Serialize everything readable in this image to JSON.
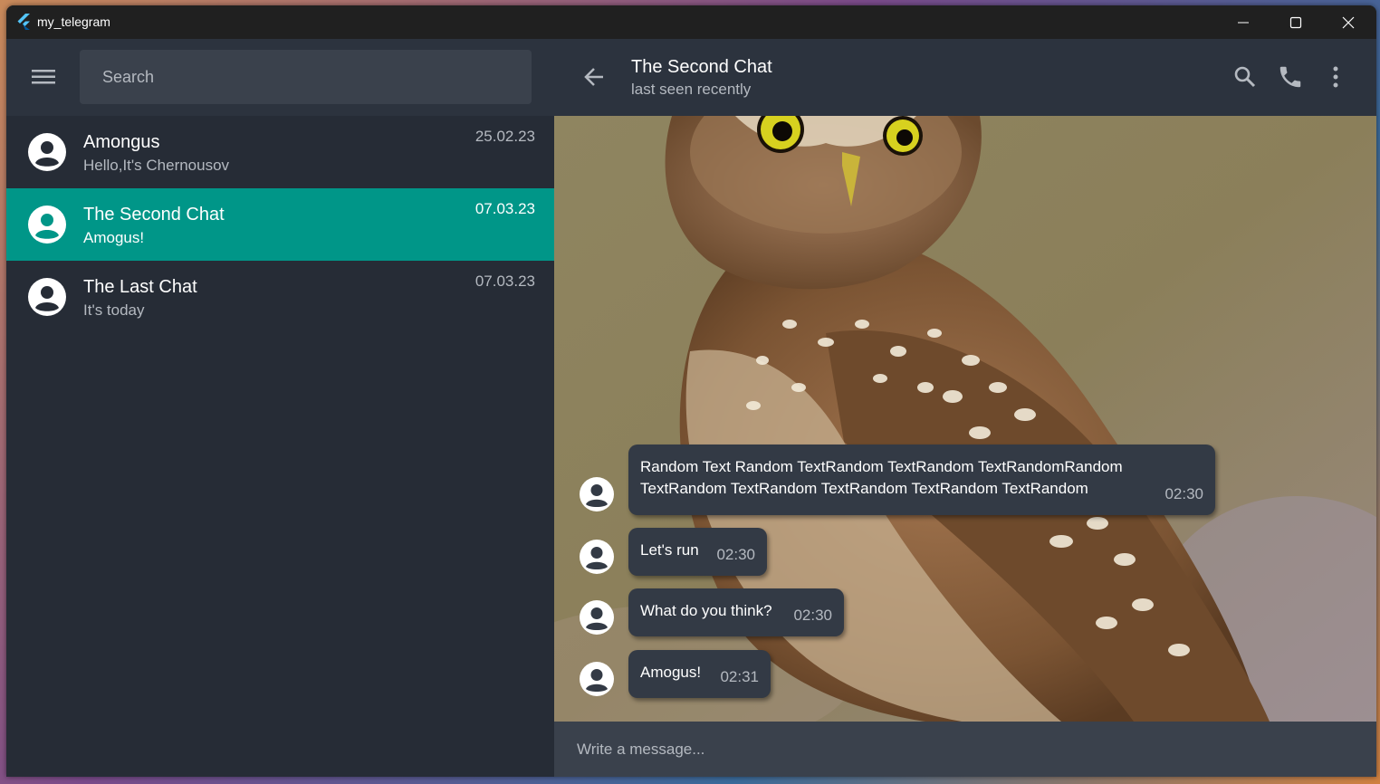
{
  "window": {
    "title": "my_telegram",
    "app_icon": "flutter-logo-icon",
    "controls": [
      "minimize-icon",
      "maximize-icon",
      "close-icon"
    ]
  },
  "sidebar": {
    "menu_icon": "hamburger-menu-icon",
    "search_placeholder": "Search",
    "chats": [
      {
        "name": "Amongus",
        "preview": "Hello,It's Chernousov",
        "date": "25.02.23",
        "active": false
      },
      {
        "name": "The Second Chat",
        "preview": "Amogus!",
        "date": "07.03.23",
        "active": true
      },
      {
        "name": "The Last Chat",
        "preview": "It's today",
        "date": "07.03.23",
        "active": false
      }
    ]
  },
  "chat": {
    "title": "The Second Chat",
    "status": "last seen recently",
    "header_icons": [
      "back-arrow-icon",
      "search-icon",
      "phone-icon",
      "more-vert-icon"
    ],
    "messages": [
      {
        "line1": "Random Text Random TextRandom TextRandom TextRandomRandom",
        "line2": "TextRandom TextRandom TextRandom TextRandom TextRandom",
        "time": "02:30"
      },
      {
        "text": "Let's run",
        "time": "02:30"
      },
      {
        "text": "What do you think?",
        "time": "02:30"
      },
      {
        "text": "Amogus!",
        "time": "02:31"
      }
    ],
    "compose_placeholder": "Write a message..."
  },
  "colors": {
    "accent": "#009688",
    "panel": "#262c36",
    "header": "#2c333e",
    "bubble": "#333a45",
    "muted_text": "#b4b9c0"
  }
}
